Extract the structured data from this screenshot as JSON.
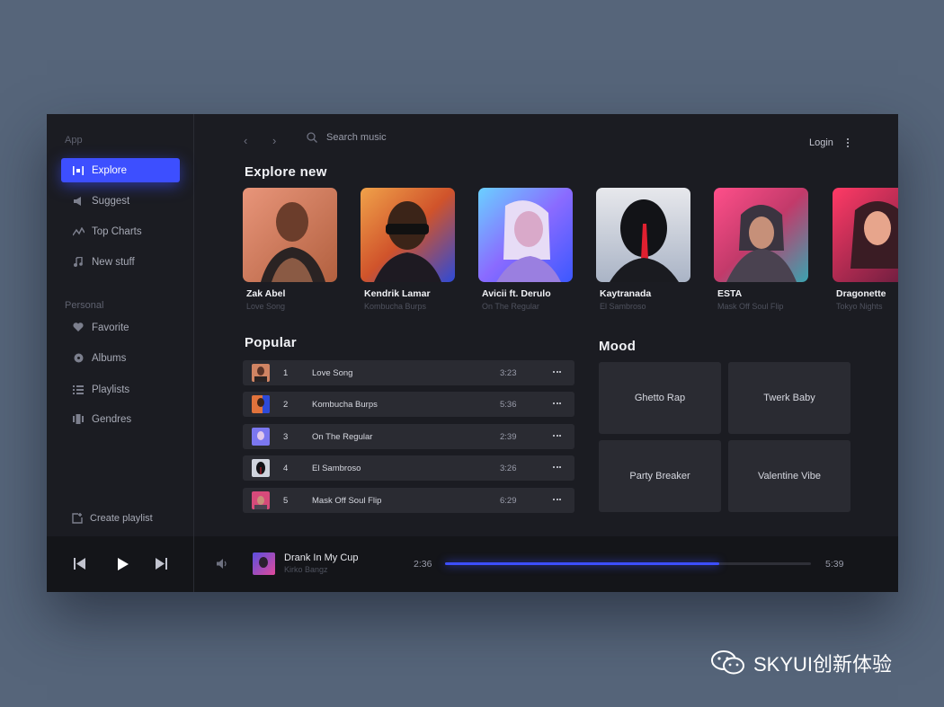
{
  "sidebar": {
    "app_label": "App",
    "items": [
      {
        "label": "Explore",
        "icon": "explore-icon"
      },
      {
        "label": "Suggest",
        "icon": "megaphone-icon"
      },
      {
        "label": "Top Charts",
        "icon": "chart-line-icon"
      },
      {
        "label": "New stuff",
        "icon": "music-note-icon"
      }
    ],
    "personal_label": "Personal",
    "personal_items": [
      {
        "label": "Favorite",
        "icon": "heart-icon"
      },
      {
        "label": "Albums",
        "icon": "disc-icon"
      },
      {
        "label": "Playlists",
        "icon": "list-icon"
      },
      {
        "label": "Gendres",
        "icon": "genres-icon"
      }
    ],
    "create_playlist": "Create playlist"
  },
  "topbar": {
    "search_placeholder": "Search music",
    "login": "Login"
  },
  "explore": {
    "title": "Explore  new",
    "cards": [
      {
        "artist": "Zak Abel",
        "song": "Love Song"
      },
      {
        "artist": "Kendrik Lamar",
        "song": "Kombucha Burps"
      },
      {
        "artist": "Avicii ft. Derulo",
        "song": "On The Regular"
      },
      {
        "artist": "Kaytranada",
        "song": "El Sambroso"
      },
      {
        "artist": "ESTA",
        "song": "Mask Off Soul Flip"
      },
      {
        "artist": "Dragonette",
        "song": "Tokyo Nights"
      }
    ]
  },
  "popular": {
    "title": "Popular",
    "tracks": [
      {
        "num": "1",
        "title": "Love Song",
        "duration": "3:23"
      },
      {
        "num": "2",
        "title": "Kombucha Burps",
        "duration": "5:36"
      },
      {
        "num": "3",
        "title": "On The Regular",
        "duration": "2:39"
      },
      {
        "num": "4",
        "title": "El Sambroso",
        "duration": "3:26"
      },
      {
        "num": "5",
        "title": "Mask Off Soul Flip",
        "duration": "6:29"
      }
    ]
  },
  "mood": {
    "title": "Mood",
    "items": [
      "Ghetto Rap",
      "Twerk Baby",
      "Party Breaker",
      "Valentine Vibe"
    ]
  },
  "player": {
    "title": "Drank In My Cup",
    "artist": "Kirko Bangz",
    "elapsed": "2:36",
    "total": "5:39",
    "progress": 0.75
  },
  "watermark": "SKYUI创新体验",
  "colors": {
    "accent": "#3d4fff",
    "background": "#1b1c22",
    "surface": "#2a2b32",
    "page": "#56657a"
  }
}
